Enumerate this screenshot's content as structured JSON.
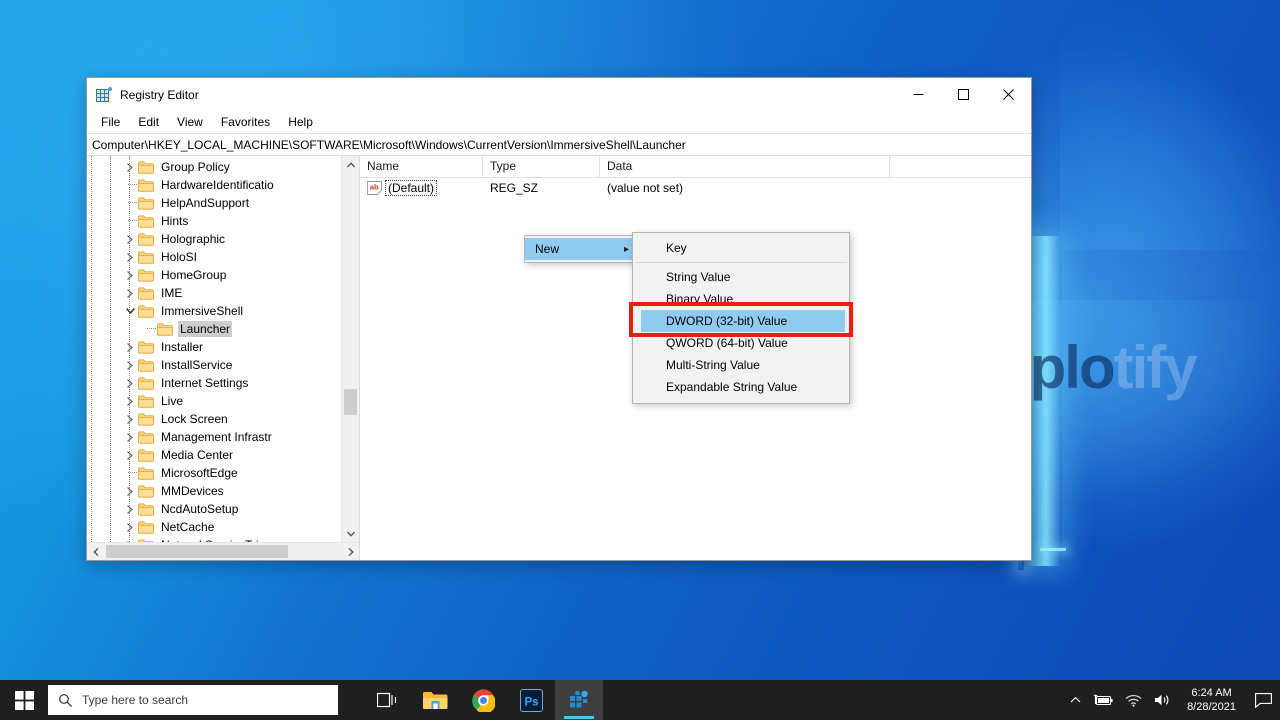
{
  "desktop": {
    "watermark_bold": "uplo",
    "watermark_faint": "tify"
  },
  "window": {
    "title": "Registry Editor",
    "icon": "registry-editor-icon",
    "controls": {
      "minimize": "minimize-icon",
      "maximize": "maximize-icon",
      "close": "close-icon"
    },
    "menus": [
      "File",
      "Edit",
      "View",
      "Favorites",
      "Help"
    ],
    "address_path": "Computer\\HKEY_LOCAL_MACHINE\\SOFTWARE\\Microsoft\\Windows\\CurrentVersion\\ImmersiveShell\\Launcher"
  },
  "tree": {
    "items": [
      {
        "label": "Group Policy",
        "indent": 5,
        "expander": "collapsed",
        "selected": false
      },
      {
        "label": "HardwareIdentificatio",
        "indent": 5,
        "expander": "none",
        "selected": false
      },
      {
        "label": "HelpAndSupport",
        "indent": 5,
        "expander": "none",
        "selected": false
      },
      {
        "label": "Hints",
        "indent": 5,
        "expander": "none",
        "selected": false
      },
      {
        "label": "Holographic",
        "indent": 5,
        "expander": "collapsed",
        "selected": false
      },
      {
        "label": "HoloSI",
        "indent": 5,
        "expander": "collapsed",
        "selected": false
      },
      {
        "label": "HomeGroup",
        "indent": 5,
        "expander": "collapsed",
        "selected": false
      },
      {
        "label": "IME",
        "indent": 5,
        "expander": "collapsed",
        "selected": false
      },
      {
        "label": "ImmersiveShell",
        "indent": 5,
        "expander": "expanded",
        "selected": false
      },
      {
        "label": "Launcher",
        "indent": 6,
        "expander": "none",
        "selected": true
      },
      {
        "label": "Installer",
        "indent": 5,
        "expander": "collapsed",
        "selected": false
      },
      {
        "label": "InstallService",
        "indent": 5,
        "expander": "collapsed",
        "selected": false
      },
      {
        "label": "Internet Settings",
        "indent": 5,
        "expander": "collapsed",
        "selected": false
      },
      {
        "label": "Live",
        "indent": 5,
        "expander": "collapsed",
        "selected": false
      },
      {
        "label": "Lock Screen",
        "indent": 5,
        "expander": "collapsed",
        "selected": false
      },
      {
        "label": "Management Infrastr",
        "indent": 5,
        "expander": "collapsed",
        "selected": false
      },
      {
        "label": "Media Center",
        "indent": 5,
        "expander": "collapsed",
        "selected": false
      },
      {
        "label": "MicrosoftEdge",
        "indent": 5,
        "expander": "none",
        "selected": false
      },
      {
        "label": "MMDevices",
        "indent": 5,
        "expander": "collapsed",
        "selected": false
      },
      {
        "label": "NcdAutoSetup",
        "indent": 5,
        "expander": "collapsed",
        "selected": false
      },
      {
        "label": "NetCache",
        "indent": 5,
        "expander": "collapsed",
        "selected": false
      },
      {
        "label": "NetworkServiceTriggs",
        "indent": 5,
        "expander": "collapsed",
        "selected": false
      }
    ]
  },
  "values": {
    "columns": [
      "Name",
      "Type",
      "Data"
    ],
    "rows": [
      {
        "name": "(Default)",
        "type": "REG_SZ",
        "data": "(value not set)",
        "icon": "string-value-icon"
      }
    ]
  },
  "context_menu": {
    "parent_label": "New",
    "parent_arrow": "chevron-right-icon",
    "items": [
      {
        "label": "Key",
        "highlighted": false
      },
      {
        "label": "String Value",
        "highlighted": false
      },
      {
        "label": "Binary Value",
        "highlighted": false
      },
      {
        "label": "DWORD (32-bit) Value",
        "highlighted": true
      },
      {
        "label": "QWORD (64-bit) Value",
        "highlighted": false
      },
      {
        "label": "Multi-String Value",
        "highlighted": false
      },
      {
        "label": "Expandable String Value",
        "highlighted": false
      }
    ],
    "highlight_color": "#ee1b11"
  },
  "taskbar": {
    "start": "windows-start-icon",
    "search_placeholder": "Type here to search",
    "search_icon": "search-icon",
    "icons": [
      {
        "name": "task-view-icon",
        "active": false
      },
      {
        "name": "file-explorer-icon",
        "active": false
      },
      {
        "name": "chrome-icon",
        "active": false
      },
      {
        "name": "photoshop-icon",
        "active": false
      },
      {
        "name": "registry-editor-taskbar-icon",
        "active": true
      }
    ],
    "tray": {
      "chevron": "show-hidden-icons-icon",
      "battery": "battery-charging-icon",
      "network": "wifi-icon",
      "volume": "volume-icon",
      "time": "6:24 AM",
      "date": "8/28/2021",
      "notifications": "action-center-icon"
    }
  }
}
